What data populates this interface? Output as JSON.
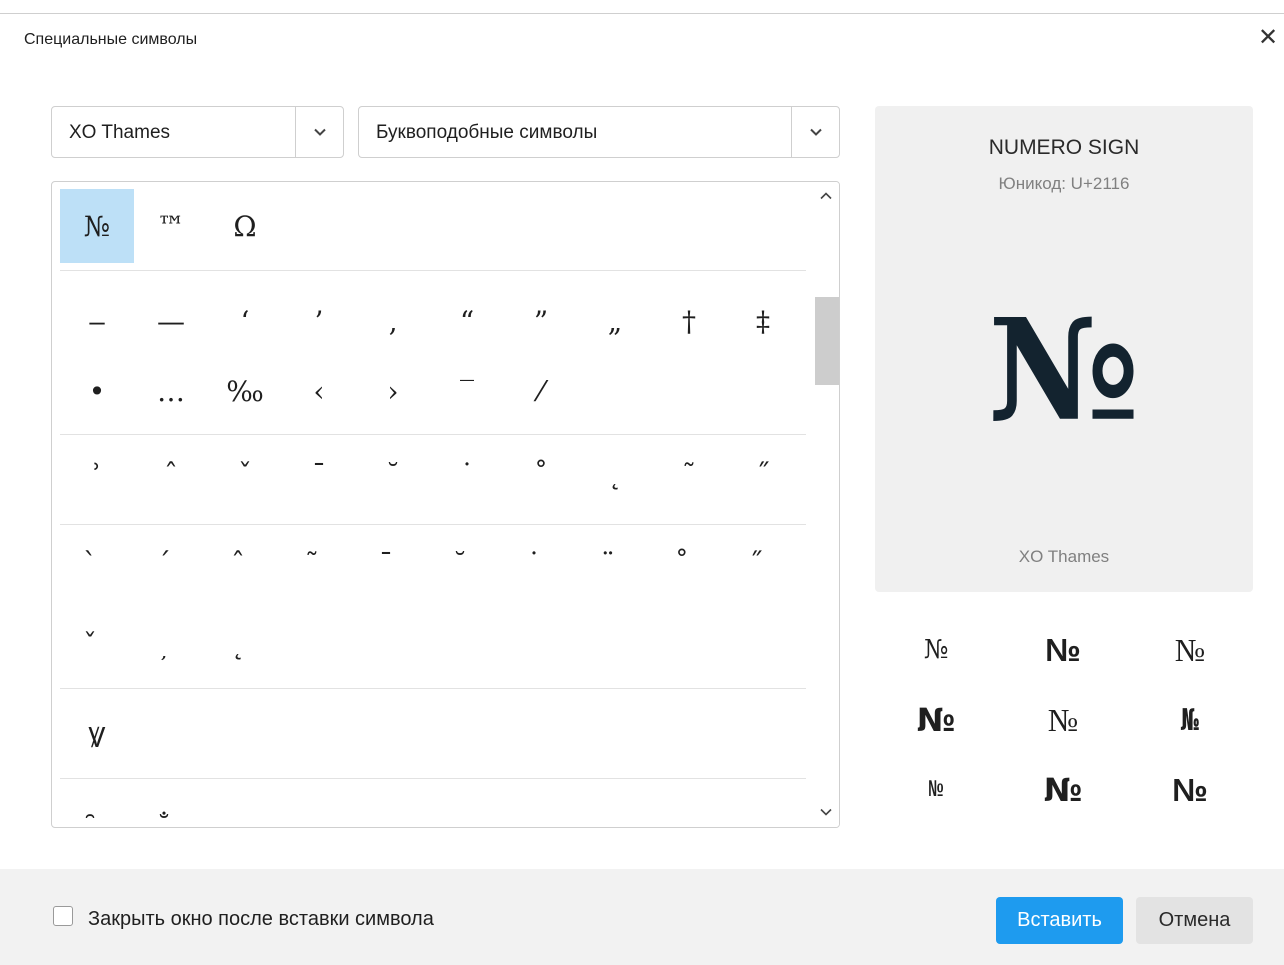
{
  "dialog": {
    "title": "Специальные символы"
  },
  "font_select": {
    "value": "XO Thames"
  },
  "block_select": {
    "value": "Буквоподобные символы"
  },
  "preview": {
    "name": "NUMERO SIGN",
    "code": "Юникод: U+2116",
    "glyph": "№",
    "font": "XO Thames"
  },
  "symbols": {
    "group1": [
      "№",
      "™",
      "Ω"
    ],
    "group2_row1": [
      "‒",
      "—",
      "‘",
      "’",
      "‚",
      "“",
      "”",
      "„",
      "†",
      "‡"
    ],
    "group2_row2": [
      "•",
      "…",
      "‰",
      "‹",
      "›",
      "‾",
      "⁄"
    ],
    "group3": [
      "ʾ",
      "ˆ",
      "ˇ",
      "ˉ",
      "˘",
      "˙",
      "˚",
      "˛",
      "˜",
      "˝"
    ],
    "group4_row1": [
      "̀",
      "́",
      "̂",
      "̃",
      "̄",
      "̆",
      "̇",
      "̈",
      "̊",
      "̋"
    ],
    "group4_row2": [
      "̌",
      "̦",
      "̨"
    ],
    "group5": [
      "Ꝟ"
    ],
    "group6": [
      "̑",
      "̐",
      "̤",
      "̱"
    ]
  },
  "variants": [
    "№",
    "№",
    "№",
    "№",
    "№",
    "№",
    "№",
    "№",
    "№"
  ],
  "footer": {
    "checkbox_label": "Закрыть окно после вставки символа",
    "checkbox_checked": false,
    "insert_label": "Вставить",
    "cancel_label": "Отмена"
  },
  "colors": {
    "accent": "#1e9bef",
    "selection": "#bde0f7",
    "preview_bg": "#f0f0f0"
  }
}
